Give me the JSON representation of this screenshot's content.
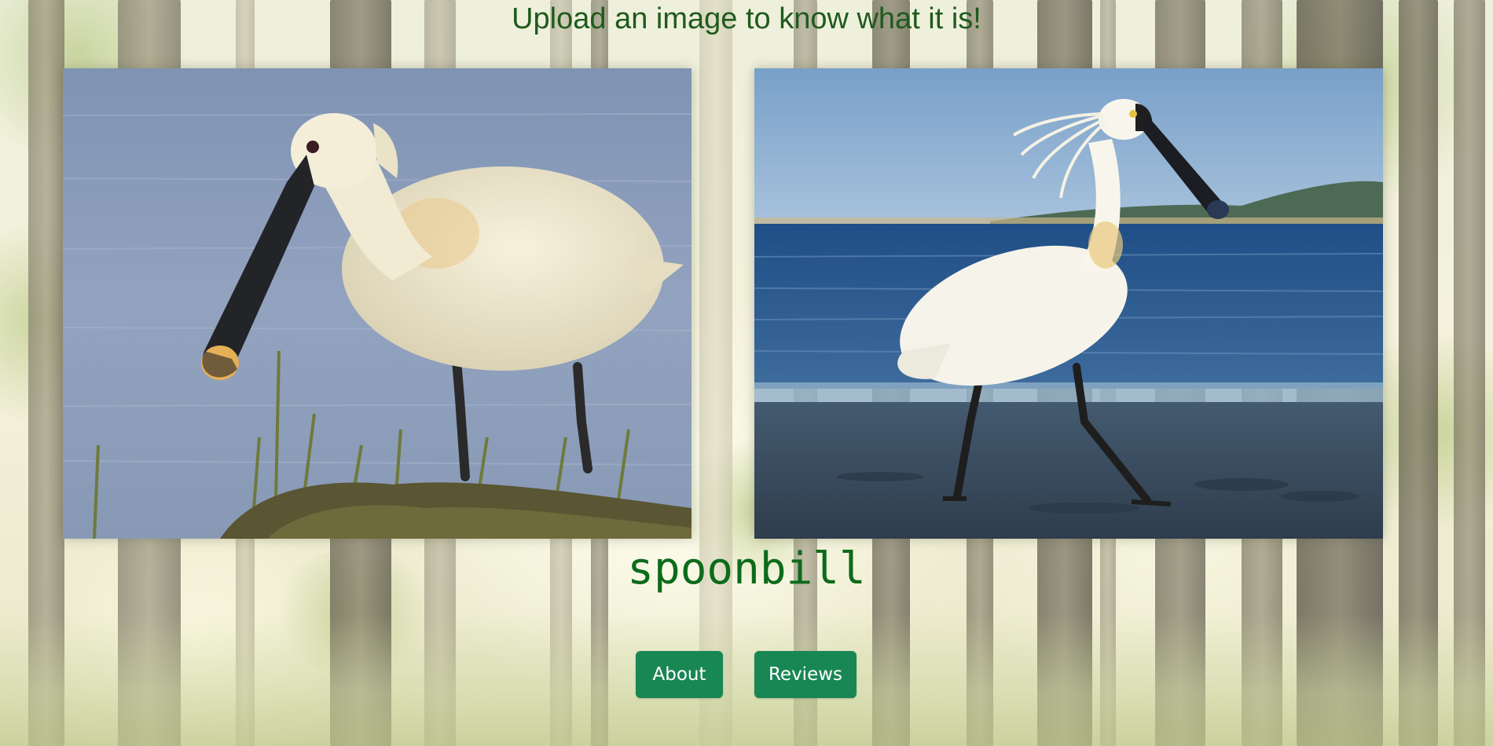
{
  "page": {
    "heading": "Upload an image to know what it is!",
    "prediction": "spoonbill"
  },
  "images": [
    {
      "subject": "Eurasian spoonbill wading in water with grass"
    },
    {
      "subject": "Royal spoonbill walking on wet shore"
    }
  ],
  "buttons": {
    "about_label": "About",
    "reviews_label": "Reviews"
  },
  "colors": {
    "heading": "#1f5a1c",
    "prediction": "#0c6b1b",
    "button_bg": "#198754",
    "button_text": "#ffffff"
  }
}
